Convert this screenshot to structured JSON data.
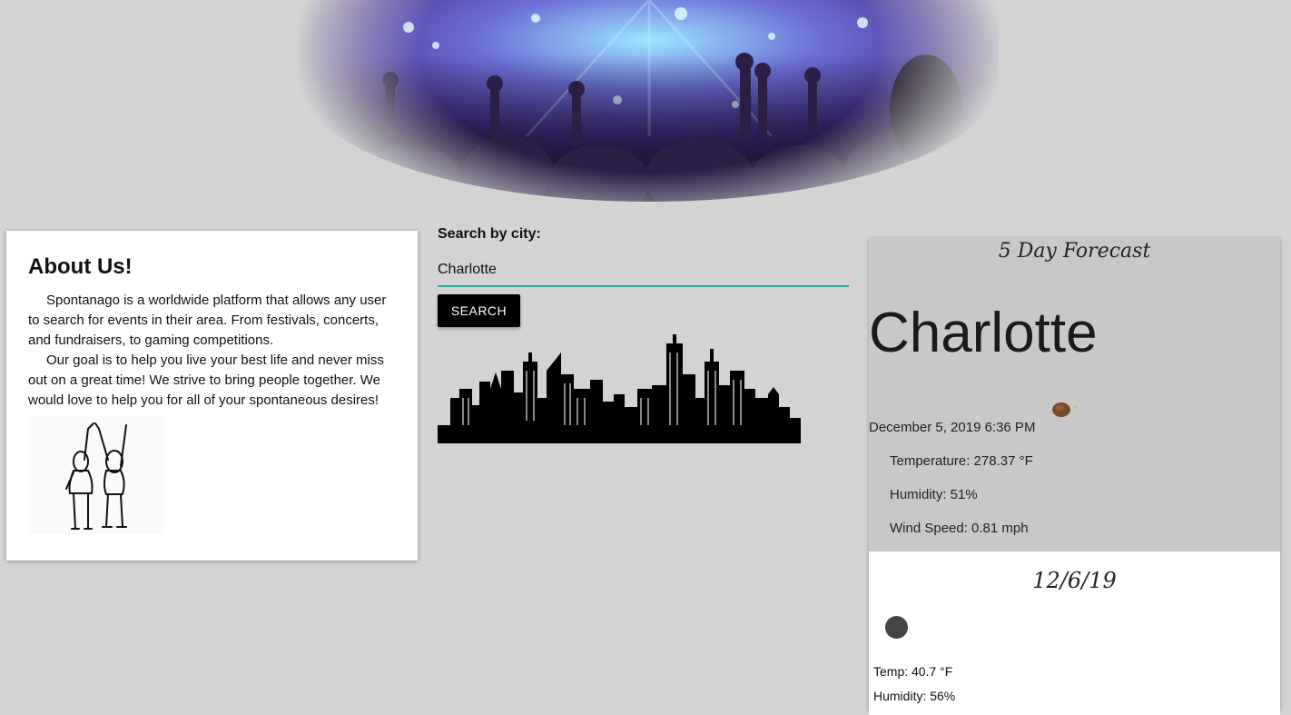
{
  "hero": {
    "icon": "concert-crowd-image"
  },
  "about": {
    "title": "About Us!",
    "paragraph1": "Spontanago is a worldwide platform that allows any user to search for events in their area. From festivals, concerts, and fundraisers, to gaming competitions.",
    "paragraph2": "Our goal is to help you live your best life and never miss out on a great time! We strive to bring people together. We would love to help you for all of your spontaneous desires!",
    "image_icon": "friends-high-five-drawing"
  },
  "search": {
    "label": "Search by city:",
    "value": "Charlotte",
    "button_label": "SEARCH",
    "accent_color": "#26a69a",
    "skyline_icon": "city-skyline-image"
  },
  "forecast": {
    "title": "5 Day Forecast",
    "city": "Charlotte",
    "weather_icon": "weather-icon",
    "date": "December 5, 2019 6:36 PM",
    "temperature": "Temperature: 278.37 °F",
    "humidity": "Humidity: 51%",
    "wind": "Wind Speed: 0.81 mph",
    "days": [
      {
        "date": "12/6/19",
        "icon": "weather-icon",
        "temp": "Temp: 40.7 °F",
        "humidity": "Humidity: 56%"
      }
    ]
  }
}
